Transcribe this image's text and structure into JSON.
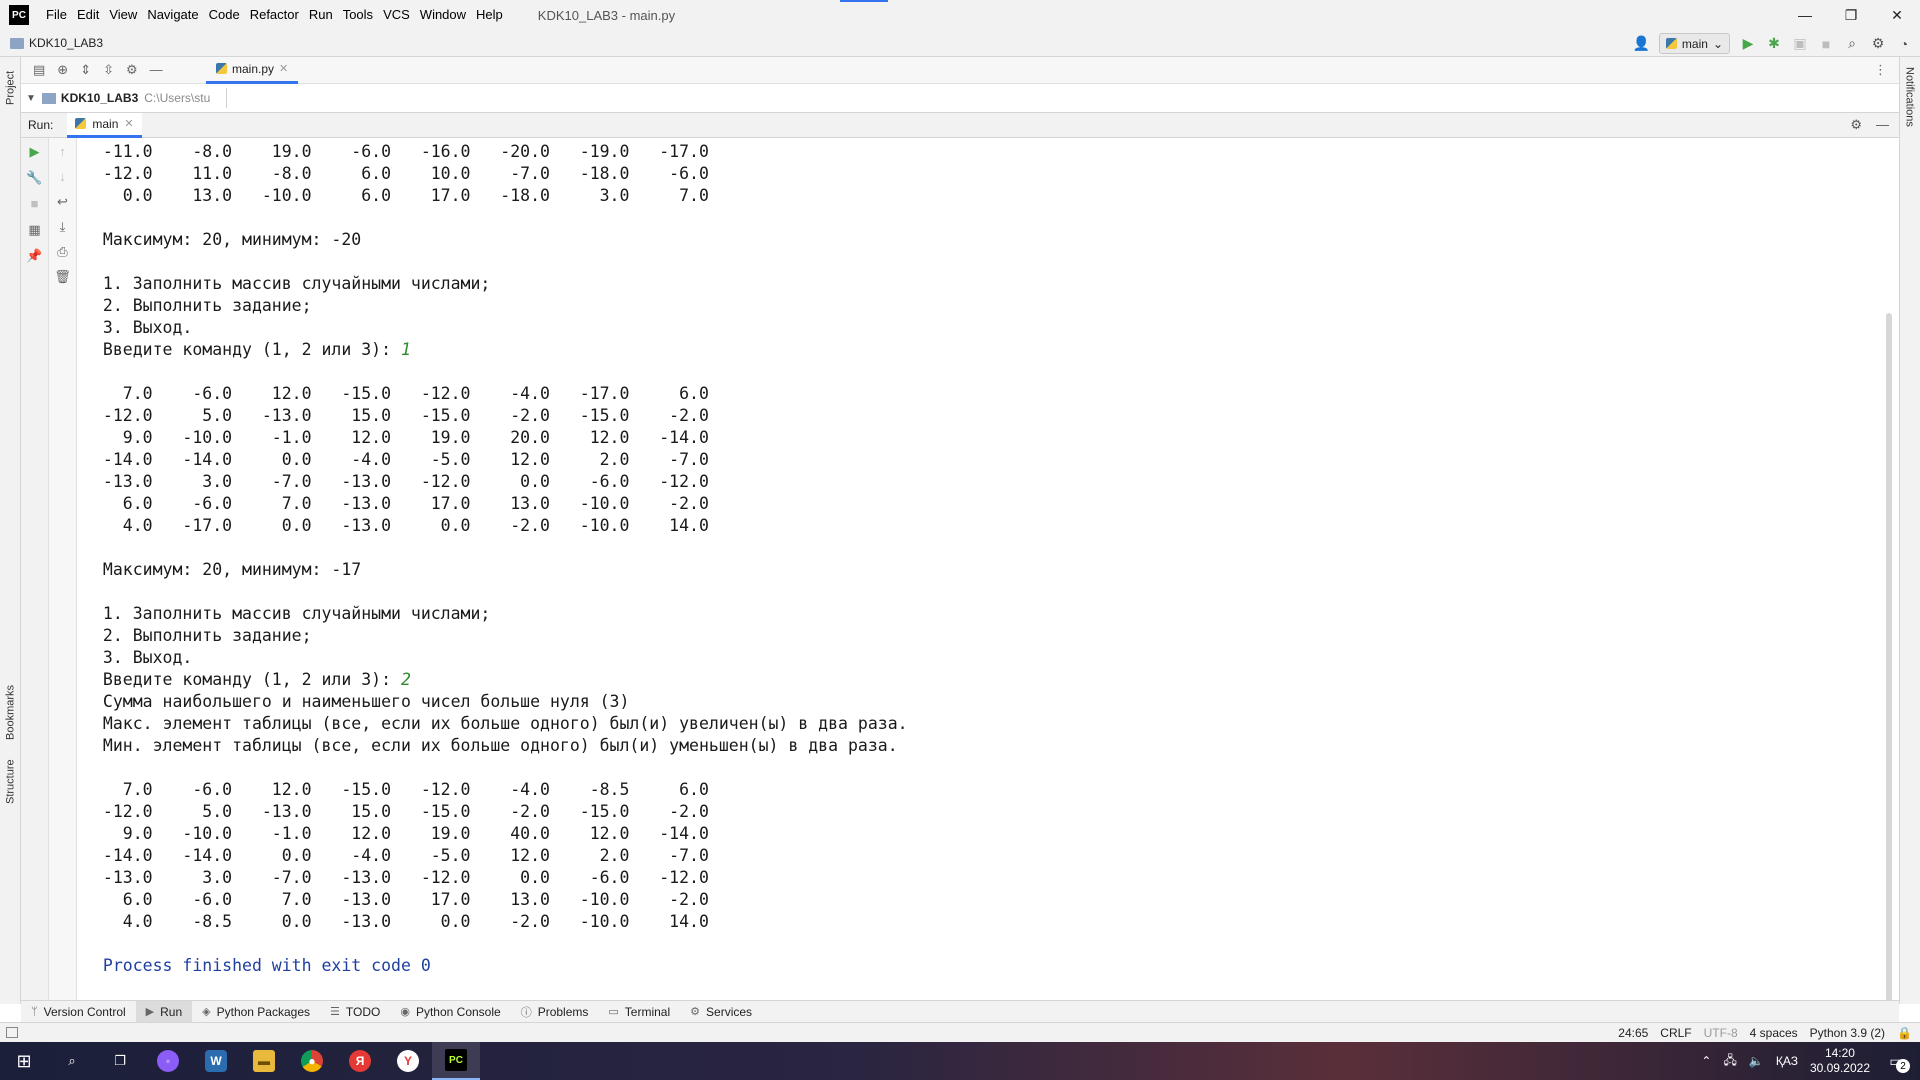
{
  "window": {
    "app_logo": "PC",
    "menu": [
      "File",
      "Edit",
      "View",
      "Navigate",
      "Code",
      "Refactor",
      "Run",
      "Tools",
      "VCS",
      "Window",
      "Help"
    ],
    "title": "KDK10_LAB3 - main.py",
    "controls": [
      "—",
      "❐",
      "✕"
    ]
  },
  "navbar": {
    "project": "KDK10_LAB3",
    "run_config": "main"
  },
  "sidebar": {
    "left_top": "Project",
    "left_bottom_1": "Bookmarks",
    "left_bottom_2": "Structure",
    "right": "Notifications"
  },
  "editor": {
    "tab_label": "main.py",
    "tree_root": "KDK10_LAB3",
    "tree_path": "C:\\Users\\stu"
  },
  "run": {
    "label": "Run:",
    "tab": "main"
  },
  "console": {
    "l01": " -11.0    -8.0    19.0    -6.0   -16.0   -20.0   -19.0   -17.0",
    "l02": " -12.0    11.0    -8.0     6.0    10.0    -7.0   -18.0    -6.0",
    "l03": "   0.0    13.0   -10.0     6.0    17.0   -18.0     3.0     7.0",
    "l04": "",
    "l05": " Максимум: 20, минимум: -20",
    "l06": "",
    "l07": " 1. Заполнить массив случайными числами;",
    "l08": " 2. Выполнить задание;",
    "l09": " 3. Выход.",
    "l10_prompt": " Введите команду (1, 2 или 3): ",
    "l10_input": "1",
    "l11": "",
    "l12": "   7.0    -6.0    12.0   -15.0   -12.0    -4.0   -17.0     6.0",
    "l13": " -12.0     5.0   -13.0    15.0   -15.0    -2.0   -15.0    -2.0",
    "l14": "   9.0   -10.0    -1.0    12.0    19.0    20.0    12.0   -14.0",
    "l15": " -14.0   -14.0     0.0    -4.0    -5.0    12.0     2.0    -7.0",
    "l16": " -13.0     3.0    -7.0   -13.0   -12.0     0.0    -6.0   -12.0",
    "l17": "   6.0    -6.0     7.0   -13.0    17.0    13.0   -10.0    -2.0",
    "l18": "   4.0   -17.0     0.0   -13.0     0.0    -2.0   -10.0    14.0",
    "l19": "",
    "l20": " Максимум: 20, минимум: -17",
    "l21": "",
    "l22": " 1. Заполнить массив случайными числами;",
    "l23": " 2. Выполнить задание;",
    "l24": " 3. Выход.",
    "l25_prompt": " Введите команду (1, 2 или 3): ",
    "l25_input": "2",
    "l26": " Сумма наибольшего и наименьшего чисел больше нуля (3)",
    "l27": " Макс. элемент таблицы (все, если их больше одного) был(и) увеличен(ы) в два раза.",
    "l28": " Мин. элемент таблицы (все, если их больше одного) был(и) уменьшен(ы) в два раза.",
    "l29": "",
    "l30": "   7.0    -6.0    12.0   -15.0   -12.0    -4.0    -8.5     6.0",
    "l31": " -12.0     5.0   -13.0    15.0   -15.0    -2.0   -15.0    -2.0",
    "l32": "   9.0   -10.0    -1.0    12.0    19.0    40.0    12.0   -14.0",
    "l33": " -14.0   -14.0     0.0    -4.0    -5.0    12.0     2.0    -7.0",
    "l34": " -13.0     3.0    -7.0   -13.0   -12.0     0.0    -6.0   -12.0",
    "l35": "   6.0    -6.0     7.0   -13.0    17.0    13.0   -10.0    -2.0",
    "l36": "   4.0    -8.5     0.0   -13.0     0.0    -2.0   -10.0    14.0",
    "l37": "",
    "l38": " Process finished with exit code 0"
  },
  "bottom_tabs": [
    "Version Control",
    "Run",
    "Python Packages",
    "TODO",
    "Python Console",
    "Problems",
    "Terminal",
    "Services"
  ],
  "status": {
    "position": "24:65",
    "line_sep": "CRLF",
    "encoding": "UTF-8",
    "indent": "4 spaces",
    "interpreter": "Python 3.9 (2)"
  },
  "taskbar": {
    "lang": "ҚАЗ",
    "time": "14:20",
    "date": "30.09.2022",
    "notif_count": "2"
  }
}
